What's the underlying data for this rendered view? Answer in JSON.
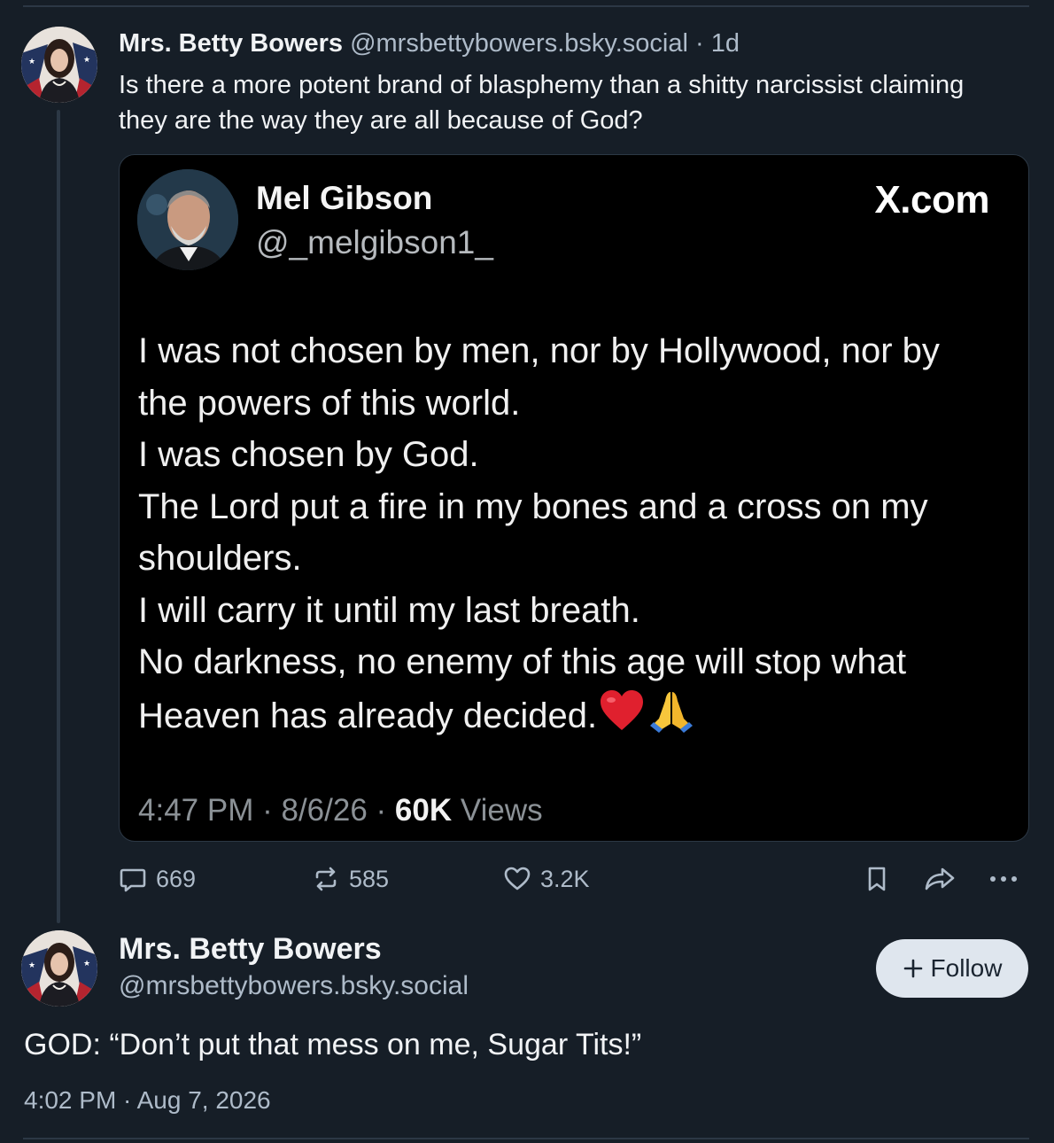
{
  "post": {
    "author_name": "Mrs. Betty Bowers",
    "author_handle": "@mrsbettybowers.bsky.social",
    "separator": "·",
    "age": "1d",
    "text": "Is there a more potent brand of blasphemy than a shitty narcissist claiming they are the way they are all because of God?"
  },
  "embed": {
    "name": "Mel Gibson",
    "handle": "@_melgibson1_",
    "site": "X.com",
    "lines": [
      "I was not chosen by men, nor by Hollywood, nor by",
      "the powers of this world.",
      "I was chosen by God.",
      "The Lord put a fire in my bones and a cross on my",
      "shoulders.",
      "I will carry it until my last breath.",
      "No darkness, no enemy of this age will stop what",
      "Heaven has already decided."
    ],
    "emojis": [
      "heart-emoji",
      "praying-hands-emoji"
    ],
    "time": "4:47 PM",
    "date": "8/6/26",
    "dot": "·",
    "views_count": "60K",
    "views_label": "Views"
  },
  "actions": {
    "replies": "669",
    "reposts": "585",
    "likes": "3.2K"
  },
  "reply": {
    "author_name": "Mrs. Betty Bowers",
    "author_handle": "@mrsbettybowers.bsky.social",
    "follow_label": "Follow",
    "text": "GOD: “Don’t put that mess on me, Sugar Tits!”",
    "timestamp": "4:02 PM · Aug 7, 2026"
  },
  "colors": {
    "background": "#161e27",
    "muted_text": "#aebbc9",
    "follow_button": "#dfe6ee"
  }
}
